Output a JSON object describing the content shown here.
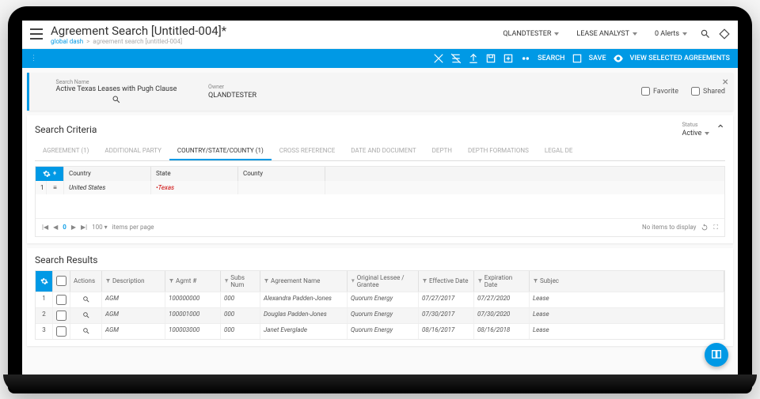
{
  "header": {
    "title": "Agreement Search [Untitled-004]*",
    "breadcrumb_link": "global dash",
    "breadcrumb_trail": "agreement search [untitled-004]",
    "user": "QLANDTESTER",
    "role": "LEASE ANALYST",
    "alerts": "0 Alerts"
  },
  "actionbar": {
    "search": "SEARCH",
    "save": "SAVE",
    "view_selected": "VIEW SELECTED AGREEMENTS"
  },
  "search_name": {
    "label": "Search Name",
    "value": "Active Texas Leases with Pugh Clause",
    "owner_label": "Owner",
    "owner_value": "QLANDTESTER",
    "favorite": "Favorite",
    "shared": "Shared"
  },
  "criteria": {
    "title": "Search Criteria",
    "status_label": "Status",
    "status_value": "Active",
    "tabs": [
      "AGREEMENT (1)",
      "ADDITIONAL PARTY",
      "COUNTRY/STATE/COUNTY (1)",
      "CROSS REFERENCE",
      "DATE AND DOCUMENT",
      "DEPTH",
      "DEPTH FORMATIONS",
      "LEGAL DE"
    ],
    "active_tab": 2,
    "grid": {
      "headers": {
        "country": "Country",
        "state": "State",
        "county": "County"
      },
      "rows": [
        {
          "idx": "1",
          "country": "United States",
          "state": "Texas",
          "county": ""
        }
      ]
    },
    "pager": {
      "page": "0",
      "per_page": "100",
      "per_page_label": "items per page",
      "no_items": "No items to display"
    }
  },
  "results": {
    "title": "Search Results",
    "columns": {
      "actions": "Actions",
      "description": "Description",
      "agmt": "Agmt #",
      "subs": "Subs Num",
      "name": "Agreement Name",
      "lessee": "Original Lessee / Grantee",
      "eff": "Effective Date",
      "exp": "Expiration Date",
      "subj": "Subjec"
    },
    "rows": [
      {
        "idx": "1",
        "desc": "AGM",
        "agmt": "100000000",
        "subs": "000",
        "name": "Alexandra Padden-Jones",
        "lessee": "Quorum Energy",
        "eff": "07/27/2017",
        "exp": "07/27/2020",
        "subj": "Lease"
      },
      {
        "idx": "2",
        "desc": "AGM",
        "agmt": "100001000",
        "subs": "000",
        "name": "Douglas Padden-Jones",
        "lessee": "Quorum Energy",
        "eff": "07/30/2017",
        "exp": "07/30/2020",
        "subj": "Lease"
      },
      {
        "idx": "3",
        "desc": "AGM",
        "agmt": "100003000",
        "subs": "000",
        "name": "Janet Everglade",
        "lessee": "Quorum Energy",
        "eff": "08/16/2017",
        "exp": "08/16/2018",
        "subj": "Lease"
      }
    ]
  }
}
